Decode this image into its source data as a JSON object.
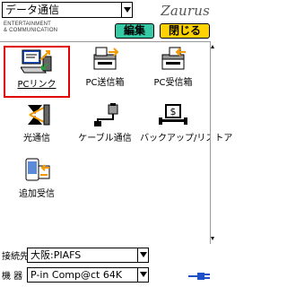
{
  "header": {
    "category": "データ通信",
    "brand": "Zaurus",
    "tagline_line1": "ENTERTAINMENT",
    "tagline_line2": "& COMMUNICATION",
    "edit_label": "編集",
    "close_label": "閉じる"
  },
  "apps": [
    {
      "label": "PCリンク",
      "icon": "pc-link-icon"
    },
    {
      "label": "PC送信箱",
      "icon": "pc-outbox-icon"
    },
    {
      "label": "PC受信箱",
      "icon": "pc-inbox-icon"
    },
    {
      "label": "光通信",
      "icon": "infrared-icon"
    },
    {
      "label": "ケーブル通信",
      "icon": "cable-icon"
    },
    {
      "label": "バックアップ/リストア",
      "icon": "backup-restore-icon"
    },
    {
      "label": "追加受信",
      "icon": "additional-receive-icon"
    }
  ],
  "footer": {
    "connection_label": "接続先",
    "connection_value": "大阪:PIAFS",
    "device_label": "機 器",
    "device_value": "P-in Comp@ct 64K"
  },
  "colors": {
    "edit_button": "#36c9a6",
    "close_button": "#ffd200",
    "selection": "#e00000",
    "icon_orange": "#f29a00",
    "icon_blue": "#1e50c8"
  }
}
